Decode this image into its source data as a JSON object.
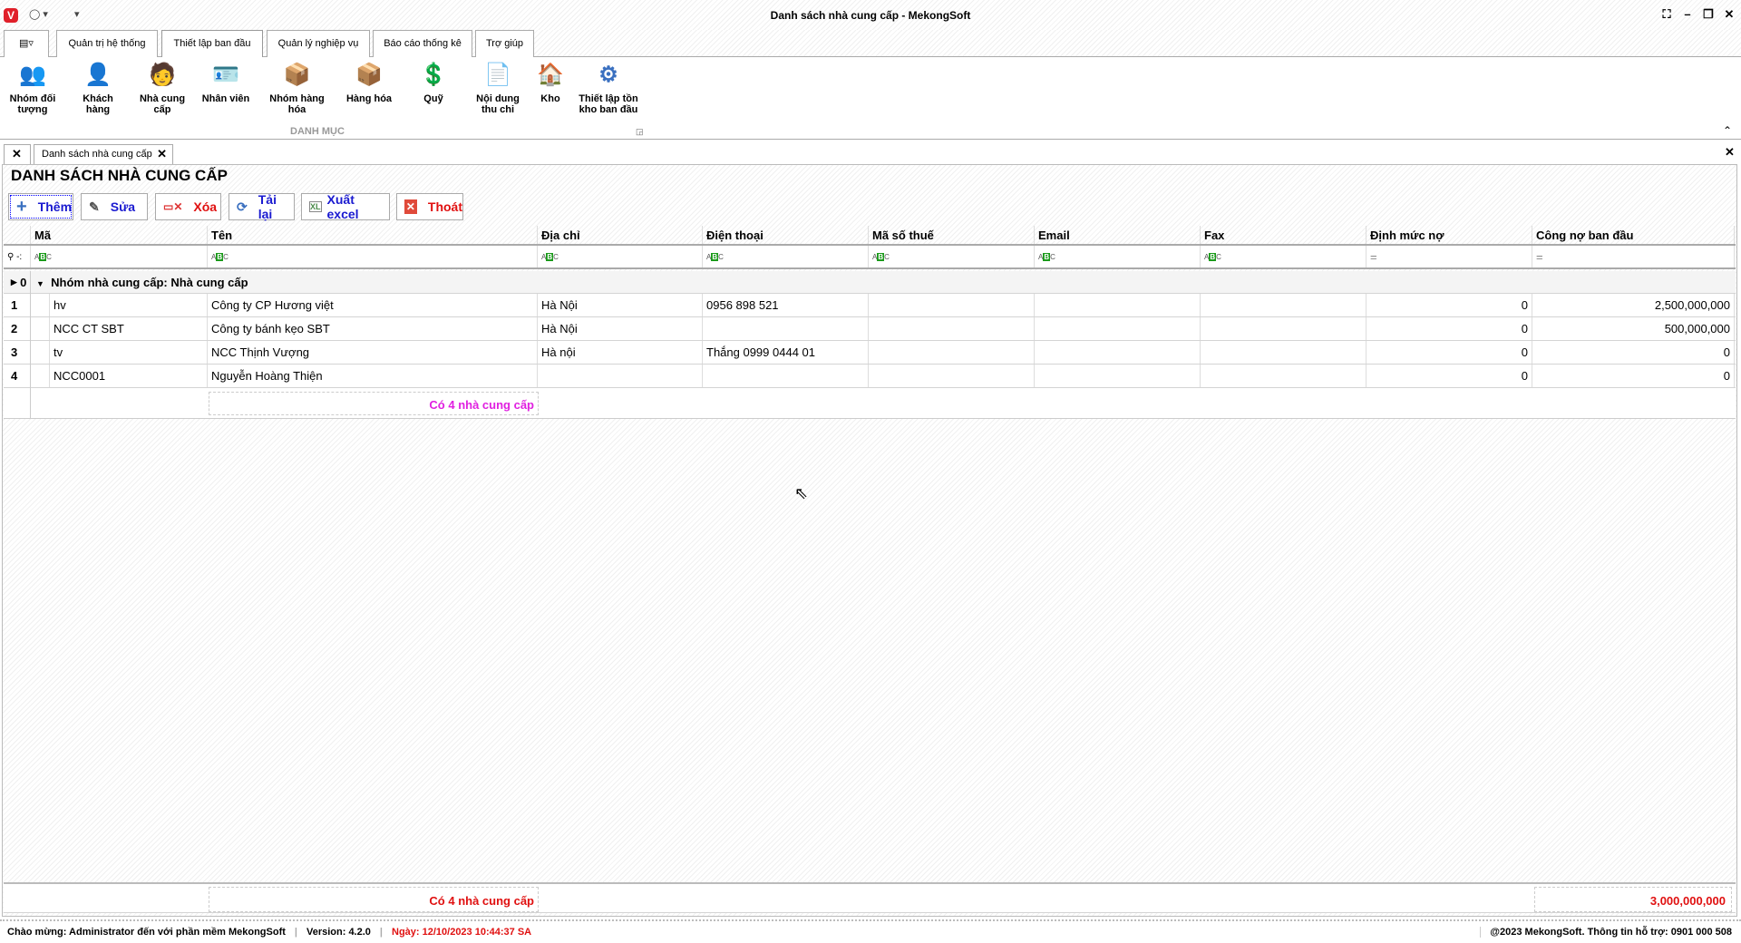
{
  "window": {
    "title": "Danh sách nhà cung cấp - MekongSoft"
  },
  "ribbon": {
    "tabs": [
      "Quản trị hệ thống",
      "Thiết lập ban đầu",
      "Quản lý nghiệp vụ",
      "Báo cáo thống kê",
      "Trợ giúp"
    ],
    "buttons": [
      {
        "label": "Nhóm đối tượng",
        "icon": "👥"
      },
      {
        "label": "Khách hàng",
        "icon": "👤"
      },
      {
        "label": "Nhà cung cấp",
        "icon": "🧑"
      },
      {
        "label": "Nhân viên",
        "icon": "🪪"
      },
      {
        "label": "Nhóm hàng hóa",
        "icon": "📦"
      },
      {
        "label": "Hàng hóa",
        "icon": "📦"
      },
      {
        "label": "Quỹ",
        "icon": "💲"
      },
      {
        "label": "Nội dung thu chi",
        "icon": "📄"
      },
      {
        "label": "Kho",
        "icon": "🏠"
      },
      {
        "label": "Thiết lập tồn kho ban đầu",
        "icon": "⚙"
      }
    ],
    "group": "DANH MỤC"
  },
  "doc_tab": "Danh sách nhà cung cấp",
  "heading": "DANH SÁCH NHÀ CUNG CẤP",
  "toolbar": {
    "add": "Thêm",
    "edit": "Sửa",
    "delete": "Xóa",
    "reload": "Tải lại",
    "export": "Xuất excel",
    "exit": "Thoát"
  },
  "grid": {
    "columns": [
      "Mã",
      "Tên",
      "Địa chỉ",
      "Điện thoại",
      "Mã số thuế",
      "Email",
      "Fax",
      "Định mức nợ",
      "Công nợ ban đầu"
    ],
    "group_label": "Nhóm nhà cung cấp: Nhà cung cấp",
    "group_index": "0",
    "rows": [
      [
        "1",
        "hv",
        "Công ty CP Hương việt",
        "Hà Nội",
        "0956 898 521",
        "",
        "",
        "",
        "0",
        "2,500,000,000"
      ],
      [
        "2",
        "NCC CT SBT",
        "Công ty bánh kẹo SBT",
        "Hà Nội",
        "",
        "",
        "",
        "",
        "0",
        "500,000,000"
      ],
      [
        "3",
        "tv",
        "NCC Thịnh Vượng",
        "Hà nội",
        "Thắng 0999 0444 01",
        "",
        "",
        "",
        "0",
        "0"
      ],
      [
        "4",
        "NCC0001",
        "Nguyễn Hoàng Thiện",
        "",
        "",
        "",
        "",
        "",
        "0",
        "0"
      ]
    ],
    "group_summary": "Có 4 nhà cung cấp",
    "footer_summary": "Có 4 nhà cung cấp",
    "footer_total": "3,000,000,000"
  },
  "status": {
    "welcome": "Chào mừng: Administrator đến với phần mềm MekongSoft",
    "version": "Version: 4.2.0",
    "date": "Ngày: 12/10/2023 10:44:37 SA",
    "support": "@2023 MekongSoft. Thông tin hỗ trợ: 0901 000 508"
  }
}
